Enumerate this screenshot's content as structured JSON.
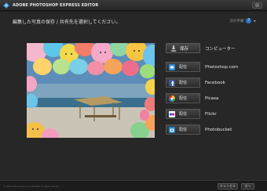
{
  "app": {
    "title": "ADOBE PHOTOSHOP EXPRESS EDITOR"
  },
  "main": {
    "instruction": "編集した写真の保存 / 共有先を選択してください。",
    "help_label": "次の手順",
    "help_icon_text": "?",
    "help_arrow": "▸"
  },
  "destinations": {
    "save": {
      "button_label": "保存",
      "target": "コンピューター"
    },
    "share_button_label": "配信",
    "services": [
      {
        "name": "Photoshop.com",
        "icon": "photoshop-com-icon",
        "color": "#2b8fd6"
      },
      {
        "name": "Facebook",
        "icon": "facebook-icon",
        "color": "#3b5998"
      },
      {
        "name": "Picasa",
        "icon": "picasa-icon",
        "color": "#d33"
      },
      {
        "name": "Flickr",
        "icon": "flickr-icon",
        "color": "#ff0084"
      },
      {
        "name": "Photobucket",
        "icon": "photobucket-icon",
        "color": "#1f86c7"
      }
    ]
  },
  "footer": {
    "copyright": "© 2008 Adobe Systems Incorporated. All rights reserved.",
    "cancel_label": "キャンセル",
    "done_label": "次へ"
  },
  "colors": {
    "accent": "#2b76c4",
    "background": "#272727"
  }
}
